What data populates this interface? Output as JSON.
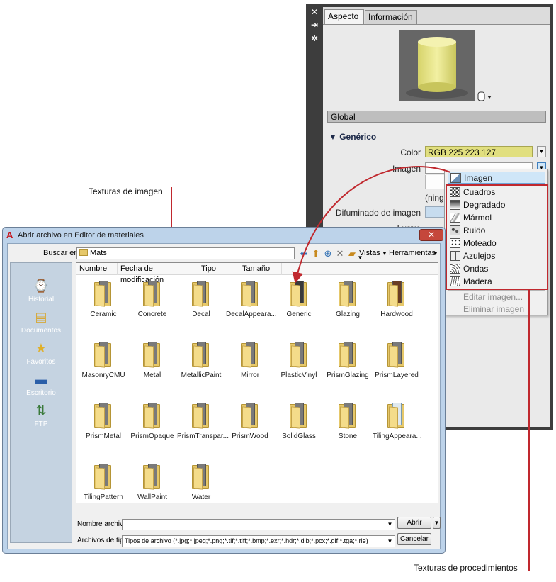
{
  "material_panel": {
    "strip_icons": [
      "close-icon",
      "pin-icon",
      "settings-icon"
    ],
    "tabs": [
      {
        "label": "Aspecto"
      },
      {
        "label": "Información"
      }
    ],
    "global_label": "Global",
    "section_title": "▼ Genérico",
    "props": {
      "color_label": "Color",
      "color_value": "RGB 225 223 127",
      "image_label": "Imagen",
      "image_none": "(ningu",
      "blur_label": "Difuminado de imagen",
      "gloss_label": "Lustre"
    },
    "colors": {
      "color_swatch": "#e1df7f",
      "accent": "#c0282e"
    }
  },
  "image_menu": {
    "selected": "Imagen",
    "procedural": [
      "Cuadros",
      "Degradado",
      "Mármol",
      "Ruido",
      "Moteado",
      "Azulejos",
      "Ondas",
      "Madera"
    ],
    "disabled": [
      "Editar imagen...",
      "Eliminar imagen"
    ]
  },
  "annotations": {
    "image_textures": "Texturas de imagen",
    "procedural_textures": "Texturas de procedimientos"
  },
  "dialog": {
    "title": "Abrir archivo en Editor de materiales",
    "close": "✕",
    "look_in_label": "Buscar en:",
    "look_in_value": "Mats",
    "toolbar": {
      "views": "Vistas",
      "tools": "Herramientas"
    },
    "places": [
      {
        "label": "Historial",
        "icon": "history-icon"
      },
      {
        "label": "Documentos",
        "icon": "documents-icon"
      },
      {
        "label": "Favoritos",
        "icon": "favorites-icon"
      },
      {
        "label": "Escritorio",
        "icon": "desktop-icon"
      },
      {
        "label": "FTP",
        "icon": "ftp-icon"
      }
    ],
    "columns": [
      "Nombre",
      "Fecha de modificación",
      "Tipo",
      "Tamaño"
    ],
    "files": [
      "Ceramic",
      "Concrete",
      "Decal",
      "DecalAppeara...",
      "Generic",
      "Glazing",
      "Hardwood",
      "MasonryCMU",
      "Metal",
      "MetallicPaint",
      "Mirror",
      "PlasticVinyl",
      "PrismGlazing",
      "PrismLayered",
      "PrismMetal",
      "PrismOpaque",
      "PrismTranspar...",
      "PrismWood",
      "SolidGlass",
      "Stone",
      "TilingAppeara...",
      "TilingPattern",
      "WallPaint",
      "Water"
    ],
    "filename_label": "Nombre archivo:",
    "filename_value": "",
    "filetype_label": "Archivos de tipo:",
    "filetype_value": "Tipos de archivo  (*.jpg;*.jpeg;*.png;*.tif;*.tiff;*.bmp;*.exr;*.hdr;*.dib;*.pcx;*.gif;*.tga;*.rle)",
    "open_button": "Abrir",
    "cancel_button": "Cancelar"
  }
}
